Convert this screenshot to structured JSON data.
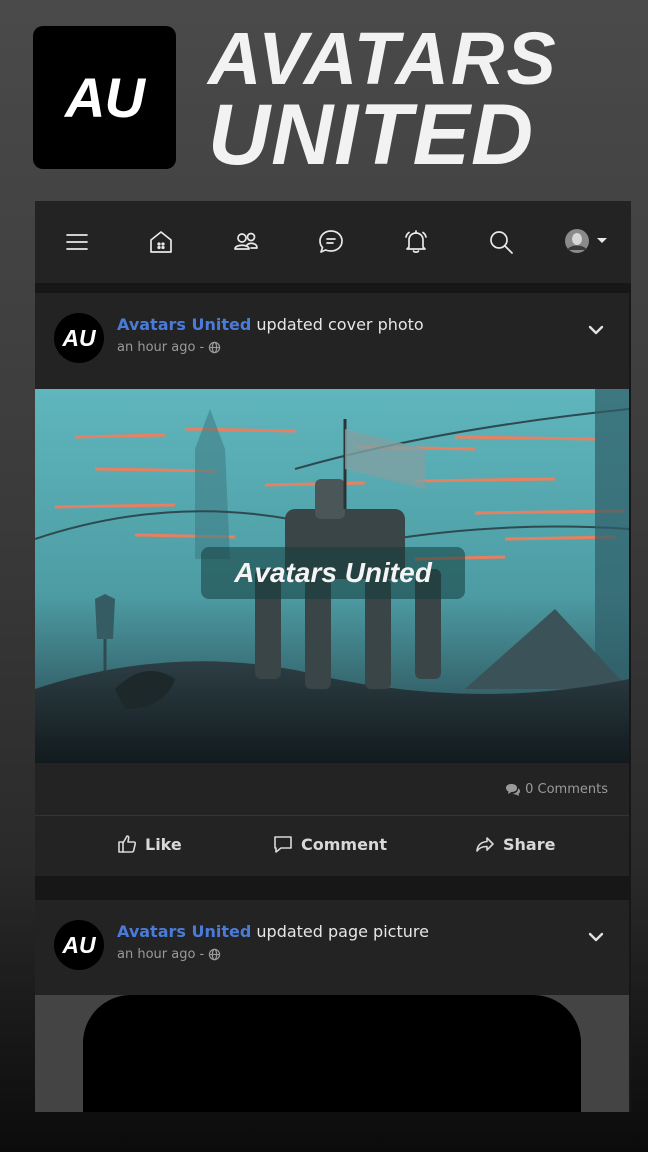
{
  "header": {
    "logo_text": "AU",
    "brand_line1": "AVATARS",
    "brand_line2": "UNITED"
  },
  "navbar": {
    "items": [
      {
        "icon": "menu-icon"
      },
      {
        "icon": "home-icon"
      },
      {
        "icon": "friends-icon"
      },
      {
        "icon": "messages-icon"
      },
      {
        "icon": "notifications-icon"
      },
      {
        "icon": "search-icon"
      },
      {
        "icon": "profile-avatar-dropdown"
      }
    ]
  },
  "posts": [
    {
      "avatar_text": "AU",
      "author": "Avatars United",
      "action": "updated cover photo",
      "time": "an hour ago -",
      "image_caption": "Avatars United",
      "comments": "0 Comments",
      "like_label": "Like",
      "comment_label": "Comment",
      "share_label": "Share"
    },
    {
      "avatar_text": "AU",
      "author": "Avatars United",
      "action": "updated page picture",
      "time": "an hour ago -"
    }
  ],
  "colors": {
    "author": "#4b7bd8",
    "card": "#232323",
    "navbar": "#232323"
  }
}
